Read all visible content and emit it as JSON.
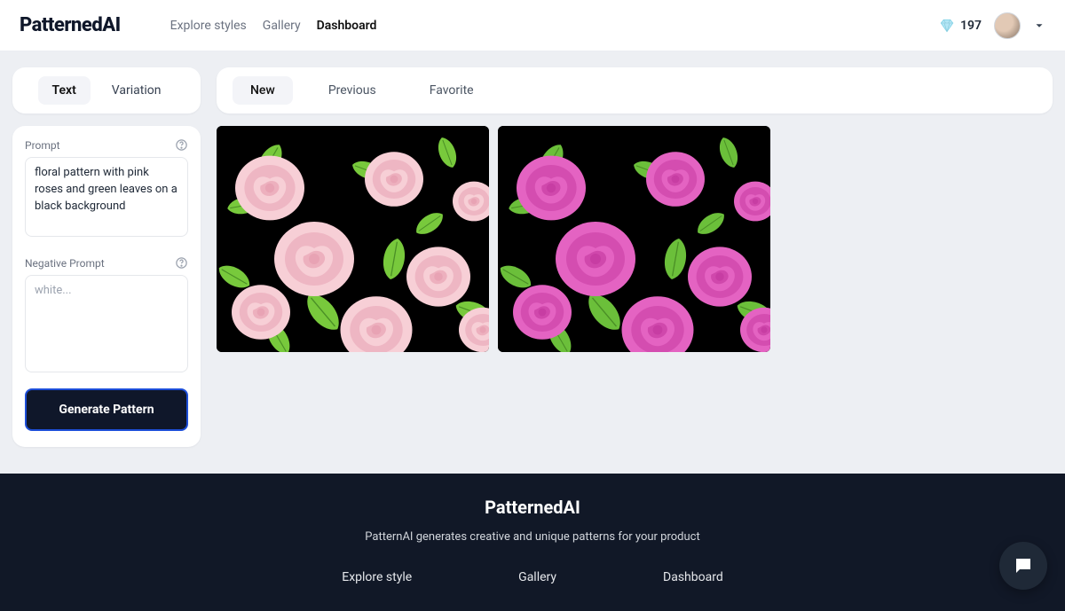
{
  "header": {
    "logo": "PatternedAI",
    "nav": [
      "Explore styles",
      "Gallery",
      "Dashboard"
    ],
    "nav_active_index": 2,
    "credits": "197"
  },
  "left": {
    "mode_tabs": [
      "Text",
      "Variation"
    ],
    "mode_active_index": 0,
    "prompt_label": "Prompt",
    "prompt_value": "floral pattern with pink roses and green leaves on a black background",
    "neg_prompt_label": "Negative Prompt",
    "neg_prompt_placeholder": "white...",
    "neg_prompt_value": "",
    "generate_label": "Generate Pattern"
  },
  "right": {
    "filter_tabs": [
      "New",
      "Previous",
      "Favorite"
    ],
    "filter_active_index": 0,
    "results": [
      {
        "style": "light-pink",
        "flower_fill": "#f7cfd6",
        "flower_accent": "#e8a3b4",
        "leaf_fill": "#78c93c"
      },
      {
        "style": "hot-pink",
        "flower_fill": "#e463c2",
        "flower_accent": "#c73da3",
        "leaf_fill": "#6bbf3a"
      }
    ]
  },
  "footer": {
    "title": "PatternedAI",
    "subtitle": "PatternAI generates creative and unique patterns for your product",
    "links": [
      "Explore style",
      "Gallery",
      "Dashboard"
    ]
  }
}
